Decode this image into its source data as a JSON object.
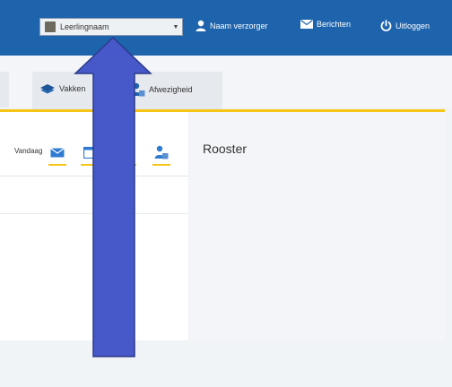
{
  "header": {
    "student_select": {
      "value": "Leerlingnaam"
    },
    "user_label": "Naam verzorger",
    "messages_label": "Berichten",
    "logout_label": "Uitloggen"
  },
  "tabs": [
    {
      "label": "Vakken"
    },
    {
      "label": "Afwezigheid"
    }
  ],
  "toolbar": {
    "label": "Vandaag"
  },
  "right_panel": {
    "title": "Rooster"
  },
  "colors": {
    "topbar": "#1e64ad",
    "accent": "#f5c518",
    "arrow": "#4759c9"
  }
}
